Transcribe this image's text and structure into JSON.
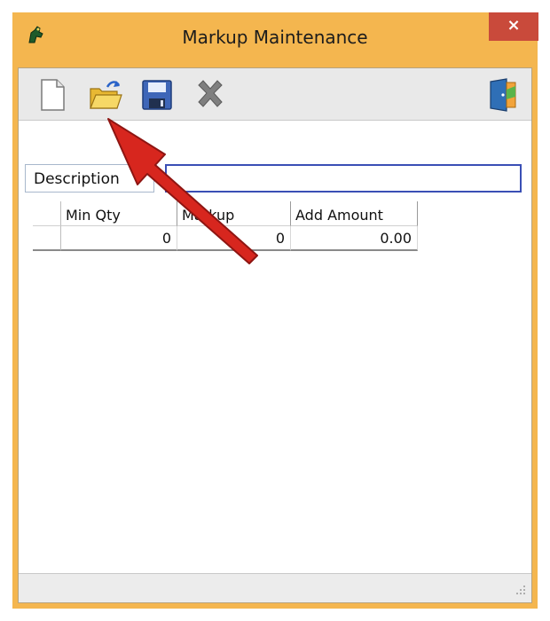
{
  "window": {
    "title": "Markup Maintenance",
    "close_symbol": "×"
  },
  "toolbar": {
    "buttons": [
      {
        "name": "new-icon"
      },
      {
        "name": "open-folder-icon"
      },
      {
        "name": "save-icon"
      },
      {
        "name": "delete-icon"
      },
      {
        "name": "exit-door-icon"
      }
    ]
  },
  "form": {
    "description_label": "Description",
    "description_value": ""
  },
  "grid": {
    "columns": [
      "Min Qty",
      "Markup",
      "Add Amount"
    ],
    "rows": [
      [
        "0",
        "0",
        "0.00"
      ]
    ]
  },
  "colors": {
    "frame": "#f4b64f",
    "close": "#c94a3b",
    "input_border": "#3a4fb5",
    "annotation_arrow": "#d7261e"
  }
}
